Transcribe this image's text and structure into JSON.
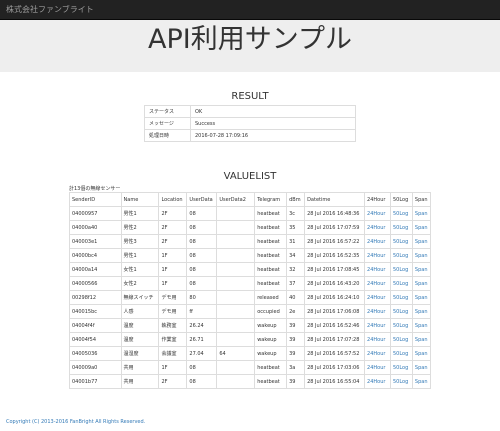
{
  "navbar": {
    "brand": "株式会社ファンブライト"
  },
  "jumbotron": {
    "title": "API利用サンプル"
  },
  "result": {
    "heading": "RESULT",
    "rows": [
      {
        "key": "ステータス",
        "value": "OK"
      },
      {
        "key": "メッセージ",
        "value": "Success"
      },
      {
        "key": "処理日時",
        "value": "2016-07-28 17:09:16"
      }
    ]
  },
  "valuelist": {
    "heading": "VALUELIST",
    "caption": "計13個の無線センサー",
    "columns": [
      "SenderID",
      "Name",
      "Location",
      "UserData",
      "UserData2",
      "Telegram",
      "dBm",
      "Datetime",
      "24Hour",
      "50Log",
      "Span"
    ],
    "rows": [
      [
        "04000957",
        "男性1",
        "2F",
        "08",
        "",
        "heatbeat",
        "3c",
        "28 Jul 2016 16:48:36",
        "24Hour",
        "50Log",
        "Span"
      ],
      [
        "04000a40",
        "男性2",
        "2F",
        "08",
        "",
        "heatbeat",
        "35",
        "28 Jul 2016 17:07:59",
        "24Hour",
        "50Log",
        "Span"
      ],
      [
        "040003e1",
        "男性3",
        "2F",
        "08",
        "",
        "heatbeat",
        "31",
        "28 Jul 2016 16:57:22",
        "24Hour",
        "50Log",
        "Span"
      ],
      [
        "04000bc4",
        "男性1",
        "1F",
        "08",
        "",
        "heatbeat",
        "34",
        "28 Jul 2016 16:52:35",
        "24Hour",
        "50Log",
        "Span"
      ],
      [
        "04000a14",
        "女性1",
        "1F",
        "08",
        "",
        "heatbeat",
        "32",
        "28 Jul 2016 17:08:45",
        "24Hour",
        "50Log",
        "Span"
      ],
      [
        "04000566",
        "女性2",
        "1F",
        "08",
        "",
        "heatbeat",
        "37",
        "28 Jul 2016 16:43:20",
        "24Hour",
        "50Log",
        "Span"
      ],
      [
        "00298f12",
        "無線スイッチ",
        "デモ用",
        "80",
        "",
        "released",
        "40",
        "28 Jul 2016 16:24:10",
        "24Hour",
        "50Log",
        "Span"
      ],
      [
        "040015bc",
        "人感",
        "デモ用",
        "ff",
        "",
        "occupied",
        "2e",
        "28 Jul 2016 17:06:08",
        "24Hour",
        "50Log",
        "Span"
      ],
      [
        "04004f4f",
        "温度",
        "執務室",
        "26.24",
        "",
        "wakeup",
        "39",
        "28 Jul 2016 16:52:46",
        "24Hour",
        "50Log",
        "Span"
      ],
      [
        "04004f54",
        "温度",
        "作業室",
        "26.71",
        "",
        "wakeup",
        "39",
        "28 Jul 2016 17:07:28",
        "24Hour",
        "50Log",
        "Span"
      ],
      [
        "04005036",
        "温湿度",
        "会議室",
        "27.04",
        "64",
        "wakeup",
        "39",
        "28 Jul 2016 16:57:52",
        "24Hour",
        "50Log",
        "Span"
      ],
      [
        "040009a0",
        "共用",
        "1F",
        "08",
        "",
        "heatbeat",
        "3a",
        "28 Jul 2016 17:03:06",
        "24Hour",
        "50Log",
        "Span"
      ],
      [
        "04001b77",
        "共用",
        "2F",
        "08",
        "",
        "heatbeat",
        "39",
        "28 Jul 2016 16:55:04",
        "24Hour",
        "50Log",
        "Span"
      ]
    ]
  },
  "footer": {
    "text": "Copyright (C) 2013-2016 FanBright All Rights Reserved."
  }
}
